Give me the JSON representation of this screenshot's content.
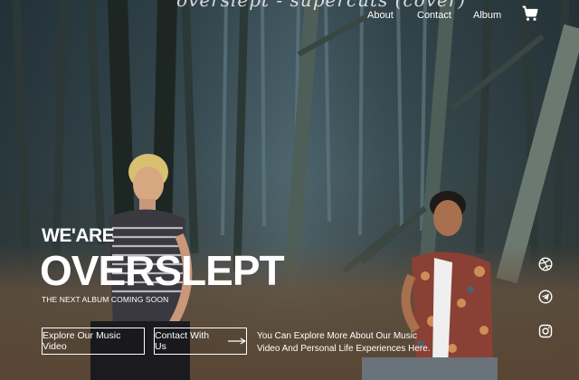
{
  "header": {
    "logo_text": "overslept - supercuts (cover)",
    "nav": [
      {
        "label": "About"
      },
      {
        "label": "Contact"
      },
      {
        "label": "Album"
      }
    ],
    "cart_icon": "shopping-cart-icon"
  },
  "hero": {
    "kicker": "WE'ARE",
    "title": "OVERSLEPT",
    "subtitle": "THE NEXT ALBUM COMING SOON",
    "buttons": {
      "explore": "Explore Our Music Video",
      "contact": "Contact With Us",
      "contact_icon": "long-arrow-right-icon"
    },
    "description": "You Can Explore More About Our Music Video And Personal Life Experiences Here."
  },
  "social": [
    {
      "icon": "dribbble-icon"
    },
    {
      "icon": "telegram-icon"
    },
    {
      "icon": "instagram-icon"
    }
  ],
  "colors": {
    "text": "#ffffff",
    "background_dark": "#22302f"
  }
}
